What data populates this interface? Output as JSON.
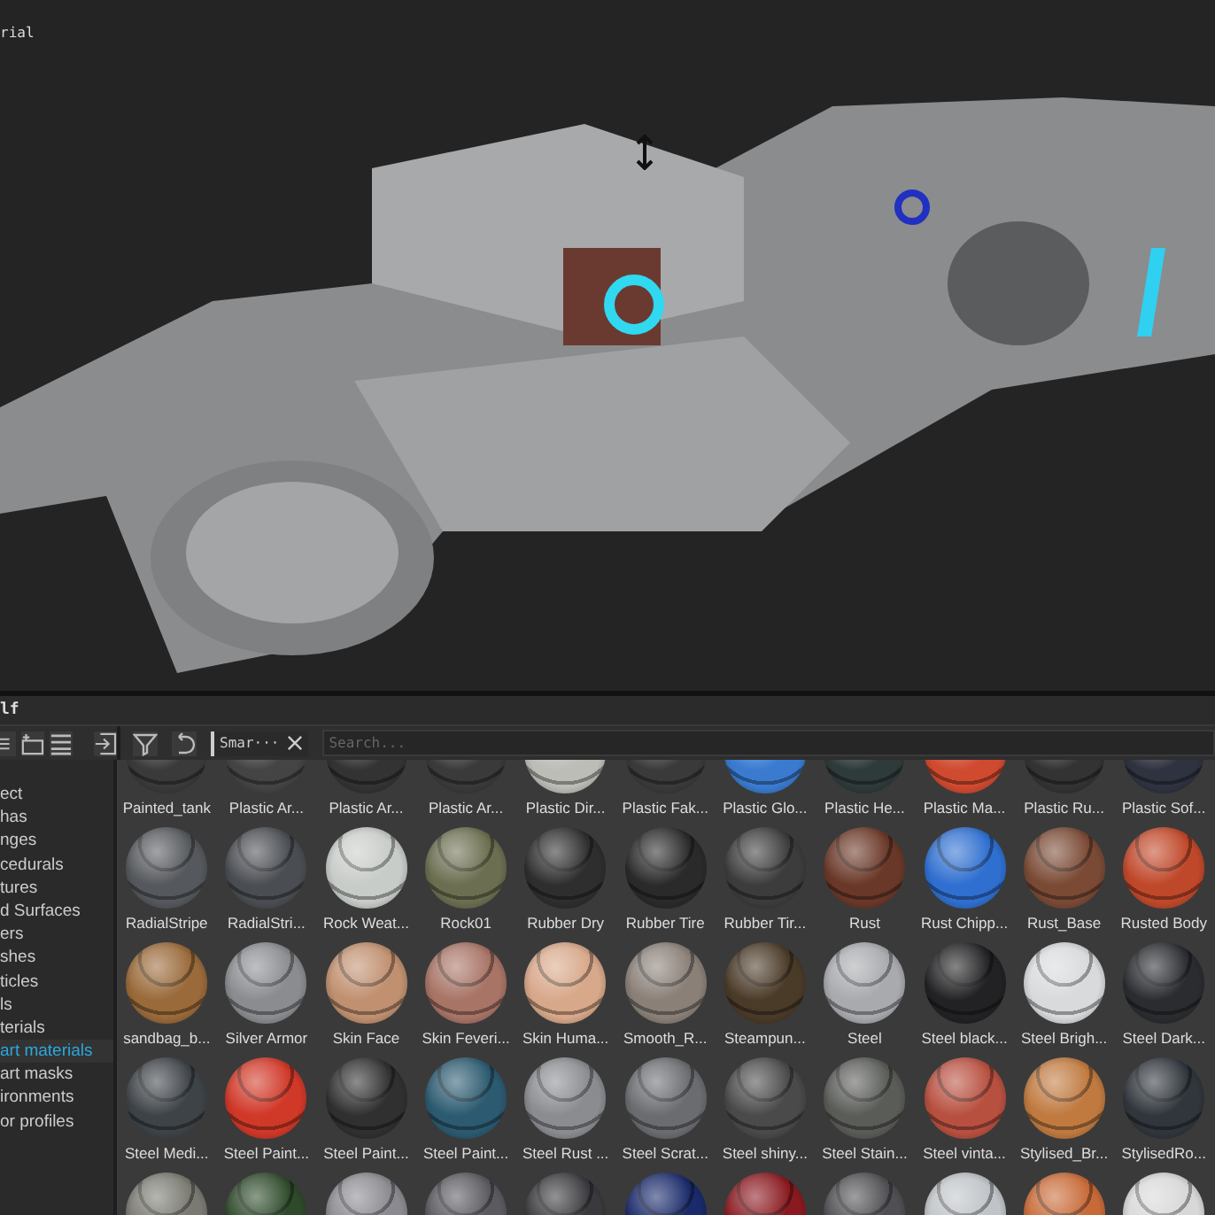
{
  "viewport": {
    "label": "rial"
  },
  "panel": {
    "title": "lf"
  },
  "toolbar": {
    "filter_tag": {
      "label": "Smar···"
    },
    "search": {
      "placeholder": "Search..."
    }
  },
  "sidebar": {
    "items": [
      {
        "label": "ect",
        "selected": false
      },
      {
        "label": "has",
        "selected": false
      },
      {
        "label": "nges",
        "selected": false
      },
      {
        "label": "cedurals",
        "selected": false
      },
      {
        "label": "tures",
        "selected": false
      },
      {
        "label": "d Surfaces",
        "selected": false
      },
      {
        "label": "ers",
        "selected": false
      },
      {
        "label": "shes",
        "selected": false
      },
      {
        "label": "ticles",
        "selected": false
      },
      {
        "label": "ls",
        "selected": false
      },
      {
        "label": "terials",
        "selected": false
      },
      {
        "label": "art materials",
        "selected": true
      },
      {
        "label": "art masks",
        "selected": false
      },
      {
        "label": "ironments",
        "selected": false
      },
      {
        "label": "or profiles",
        "selected": false
      }
    ]
  },
  "materials": {
    "rows": [
      [
        {
          "label": "Painted_tank",
          "color": "#3a3a3a"
        },
        {
          "label": "Plastic Ar...",
          "color": "#444444"
        },
        {
          "label": "Plastic Ar...",
          "color": "#333333"
        },
        {
          "label": "Plastic Ar...",
          "color": "#3a3a3a"
        },
        {
          "label": "Plastic Dir...",
          "color": "#bdbdb8"
        },
        {
          "label": "Plastic Fak...",
          "color": "#3a3a3a"
        },
        {
          "label": "Plastic Glo...",
          "color": "#3a7bd0"
        },
        {
          "label": "Plastic He...",
          "color": "#2f3a3a"
        },
        {
          "label": "Plastic Ma...",
          "color": "#d04a30"
        },
        {
          "label": "Plastic Ru...",
          "color": "#333333"
        },
        {
          "label": "Plastic Sof...",
          "color": "#2f3340"
        }
      ],
      [
        {
          "label": "RadialStripe",
          "color": "#55585c"
        },
        {
          "label": "RadialStri...",
          "color": "#4a4d52"
        },
        {
          "label": "Rock Weat...",
          "color": "#c8ccc8"
        },
        {
          "label": "Rock01",
          "color": "#6b6e50"
        },
        {
          "label": "Rubber Dry",
          "color": "#2e2e2e"
        },
        {
          "label": "Rubber Tire",
          "color": "#2a2a2a"
        },
        {
          "label": "Rubber Tir...",
          "color": "#3c3c3c"
        },
        {
          "label": "Rust",
          "color": "#6a3828"
        },
        {
          "label": "Rust Chipp...",
          "color": "#2f6fd0"
        },
        {
          "label": "Rust_Base",
          "color": "#7a4a35"
        },
        {
          "label": "Rusted Body",
          "color": "#c0482a"
        }
      ],
      [
        {
          "label": "sandbag_b...",
          "color": "#9a6a3a"
        },
        {
          "label": "Silver Armor",
          "color": "#8a8c90"
        },
        {
          "label": "Skin Face",
          "color": "#c09070"
        },
        {
          "label": "Skin Feveri...",
          "color": "#a87466"
        },
        {
          "label": "Skin Huma...",
          "color": "#d8a88a"
        },
        {
          "label": "Smooth_R...",
          "color": "#8a8078"
        },
        {
          "label": "Steampun...",
          "color": "#4a3a28"
        },
        {
          "label": "Steel",
          "color": "#a8aaae"
        },
        {
          "label": "Steel black...",
          "color": "#222224"
        },
        {
          "label": "Steel Brigh...",
          "color": "#d8dadc"
        },
        {
          "label": "Steel Dark...",
          "color": "#2a2c30"
        }
      ],
      [
        {
          "label": "Steel Medi...",
          "color": "#3e4348"
        },
        {
          "label": "Steel Paint...",
          "color": "#d03828"
        },
        {
          "label": "Steel Paint...",
          "color": "#303030"
        },
        {
          "label": "Steel Paint...",
          "color": "#2c5a70"
        },
        {
          "label": "Steel Rust ...",
          "color": "#8a8c90"
        },
        {
          "label": "Steel Scrat...",
          "color": "#6a6c70"
        },
        {
          "label": "Steel shiny...",
          "color": "#4a4a4a"
        },
        {
          "label": "Steel Stain...",
          "color": "#5a5c58"
        },
        {
          "label": "Steel vinta...",
          "color": "#b85040"
        },
        {
          "label": "Stylised_Br...",
          "color": "#c07a40"
        },
        {
          "label": "StylisedRo...",
          "color": "#30363c"
        }
      ],
      [
        {
          "color": "#7a7a72"
        },
        {
          "color": "#2e4a2a"
        },
        {
          "color": "#8a8a90"
        },
        {
          "color": "#5a5a60"
        },
        {
          "color": "#3a3a3e"
        },
        {
          "color": "#1a2a6a"
        },
        {
          "color": "#8a1a20"
        },
        {
          "color": "#505054"
        },
        {
          "color": "#c0c4c8"
        },
        {
          "color": "#c86a38"
        },
        {
          "color": "#d8d8d8"
        }
      ]
    ]
  }
}
